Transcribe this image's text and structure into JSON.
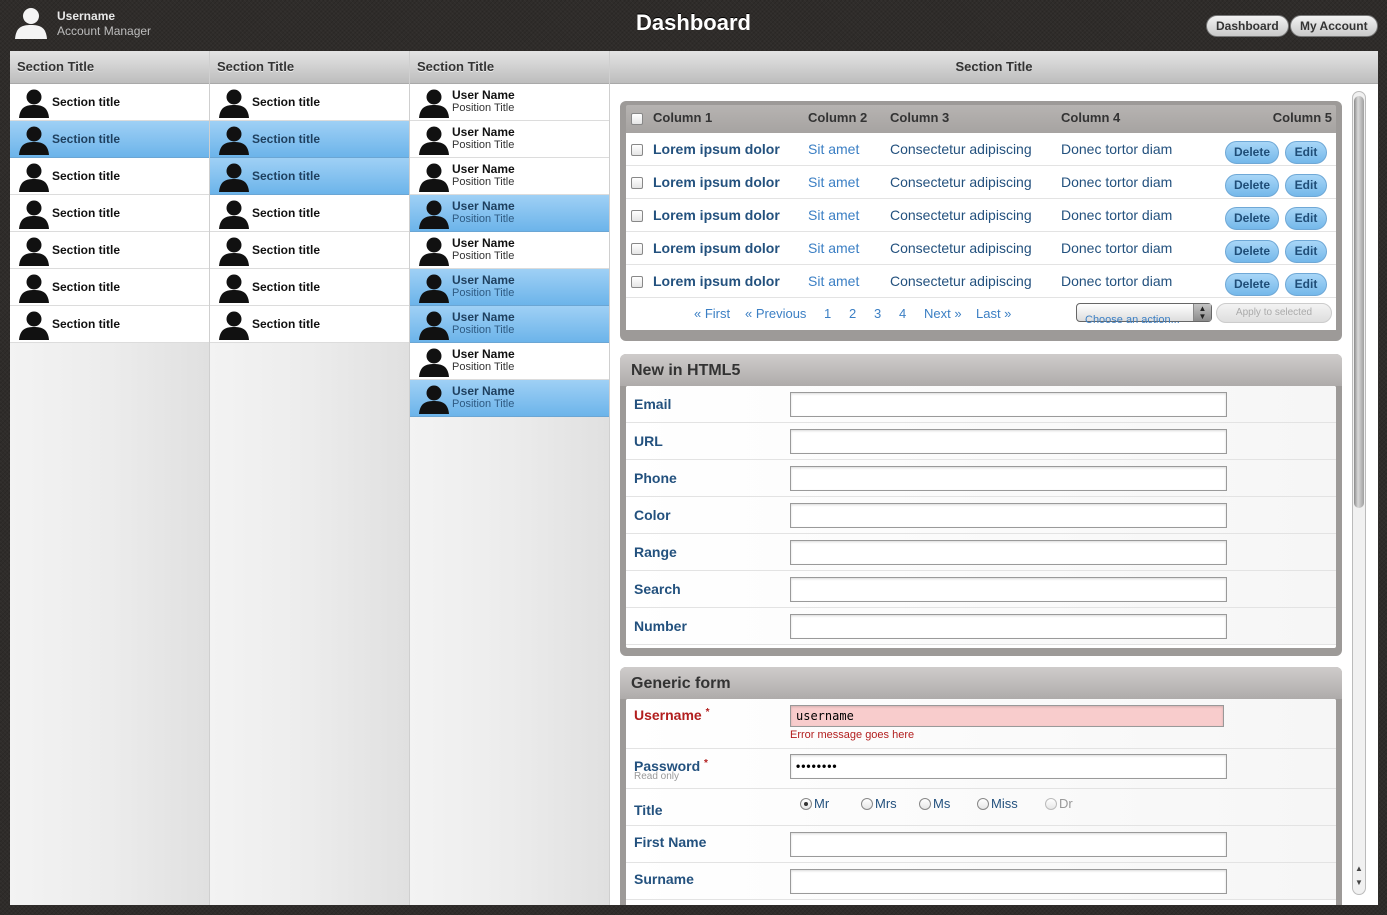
{
  "header": {
    "user_name": "Username",
    "user_role": "Account Manager",
    "title": "Dashboard",
    "buttons": {
      "dashboard": "Dashboard",
      "my_account": "My Account"
    }
  },
  "columns": {
    "col1": {
      "title": "Section Title",
      "items": [
        {
          "label": "Section title",
          "selected": false
        },
        {
          "label": "Section title",
          "selected": true
        },
        {
          "label": "Section title",
          "selected": false
        },
        {
          "label": "Section title",
          "selected": false
        },
        {
          "label": "Section title",
          "selected": false
        },
        {
          "label": "Section title",
          "selected": false
        },
        {
          "label": "Section title",
          "selected": false
        }
      ]
    },
    "col2": {
      "title": "Section Title",
      "items": [
        {
          "label": "Section title",
          "selected": false
        },
        {
          "label": "Section title",
          "selected": true
        },
        {
          "label": "Section title",
          "selected": true
        },
        {
          "label": "Section title",
          "selected": false
        },
        {
          "label": "Section title",
          "selected": false
        },
        {
          "label": "Section title",
          "selected": false
        },
        {
          "label": "Section title",
          "selected": false
        }
      ]
    },
    "col3": {
      "title": "Section Title",
      "items": [
        {
          "name": "User Name",
          "position": "Position Title",
          "selected": false
        },
        {
          "name": "User Name",
          "position": "Position Title",
          "selected": false
        },
        {
          "name": "User Name",
          "position": "Position Title",
          "selected": false
        },
        {
          "name": "User Name",
          "position": "Position Title",
          "selected": true
        },
        {
          "name": "User Name",
          "position": "Position Title",
          "selected": false
        },
        {
          "name": "User Name",
          "position": "Position Title",
          "selected": true
        },
        {
          "name": "User Name",
          "position": "Position Title",
          "selected": true
        },
        {
          "name": "User Name",
          "position": "Position Title",
          "selected": false
        },
        {
          "name": "User Name",
          "position": "Position Title",
          "selected": true
        }
      ]
    }
  },
  "main": {
    "title": "Section Title",
    "table": {
      "headers": [
        "Column 1",
        "Column 2",
        "Column 3",
        "Column 4",
        "Column 5"
      ],
      "rows": [
        [
          "Lorem ipsum dolor",
          "Sit amet",
          "Consectetur adipiscing",
          "Donec tortor diam"
        ],
        [
          "Lorem ipsum dolor",
          "Sit amet",
          "Consectetur adipiscing",
          "Donec tortor diam"
        ],
        [
          "Lorem ipsum dolor",
          "Sit amet",
          "Consectetur adipiscing",
          "Donec tortor diam"
        ],
        [
          "Lorem ipsum dolor",
          "Sit amet",
          "Consectetur adipiscing",
          "Donec tortor diam"
        ],
        [
          "Lorem ipsum dolor",
          "Sit amet",
          "Consectetur adipiscing",
          "Donec tortor diam"
        ]
      ],
      "delete_label": "Delete",
      "edit_label": "Edit",
      "pager": {
        "first": "« First",
        "previous": "« Previous",
        "pages": [
          "1",
          "2",
          "3",
          "4"
        ],
        "next": "Next »",
        "last": "Last »"
      },
      "action_select": "Choose an action...",
      "apply_label": "Apply to selected"
    },
    "html5_form": {
      "title": "New in HTML5",
      "fields": [
        "Email",
        "URL",
        "Phone",
        "Color",
        "Range",
        "Search",
        "Number"
      ]
    },
    "generic_form": {
      "title": "Generic form",
      "username_label": "Username",
      "username_value": "username",
      "required_mark": "*",
      "error_message": "Error message goes here",
      "password_label": "Password",
      "password_note": "Read only",
      "password_value": "••••••••",
      "title_label": "Title",
      "title_options": [
        {
          "label": "Mr",
          "checked": true,
          "disabled": false
        },
        {
          "label": "Mrs",
          "checked": false,
          "disabled": false
        },
        {
          "label": "Ms",
          "checked": false,
          "disabled": false
        },
        {
          "label": "Miss",
          "checked": false,
          "disabled": false
        },
        {
          "label": "Dr",
          "checked": false,
          "disabled": true
        }
      ],
      "first_name_label": "First Name",
      "surname_label": "Surname"
    }
  }
}
